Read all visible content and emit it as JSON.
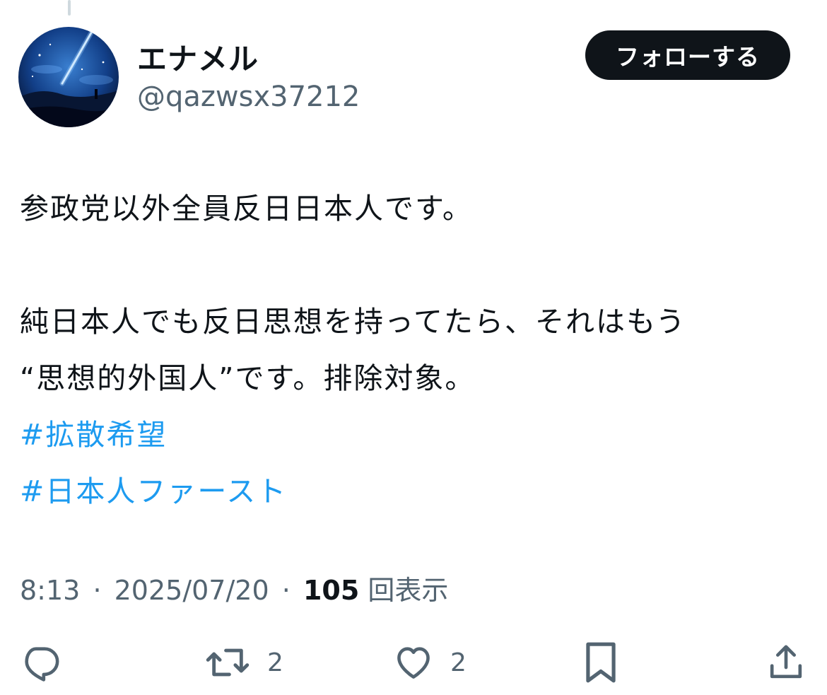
{
  "user": {
    "display_name": "エナメル",
    "handle": "@qazwsx37212",
    "avatar_icon": "night-sky-avatar"
  },
  "follow_button": {
    "label": "フォローする"
  },
  "tweet": {
    "line1": "参政党以外全員反日日本人です。",
    "line2": "純日本人でも反日思想を持ってたら、それはもう",
    "line3": "“思想的外国人”です。排除対象。",
    "hashtags": [
      "#拡散希望",
      "#日本人ファースト"
    ]
  },
  "meta": {
    "time": "8:13",
    "separator": "·",
    "date": "2025/07/20",
    "views_count": "105",
    "views_label": "回表示"
  },
  "actions": {
    "reply": {
      "icon": "reply-icon"
    },
    "retweet": {
      "icon": "retweet-icon",
      "count": "2"
    },
    "like": {
      "icon": "heart-icon",
      "count": "2"
    },
    "bookmark": {
      "icon": "bookmark-icon"
    },
    "share": {
      "icon": "share-icon"
    }
  },
  "colors": {
    "text": "#0f1419",
    "secondary": "#536471",
    "link": "#1d9bf0",
    "button_bg": "#0f1419"
  }
}
